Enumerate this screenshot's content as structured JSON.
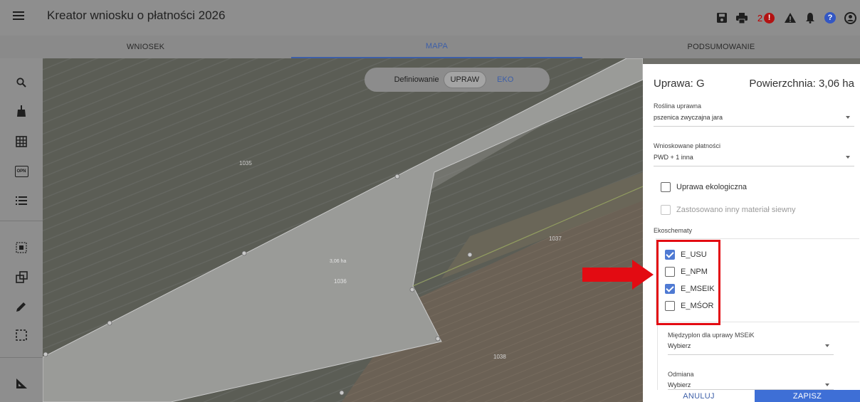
{
  "header": {
    "title": "Kreator wniosku o płatności 2026",
    "notification_count": "2",
    "icons": [
      "menu-icon",
      "save-icon",
      "print-icon",
      "error-icon",
      "warning-icon",
      "bell-icon",
      "help-icon",
      "account-icon"
    ]
  },
  "tabs": [
    {
      "label": "WNIOSEK"
    },
    {
      "label": "MAPA",
      "active": true
    },
    {
      "label": "PODSUMOWANIE"
    }
  ],
  "toolbar": {
    "icons": [
      "search-icon",
      "broom-icon",
      "grid-icon",
      "opn-icon",
      "list-icon",
      "select-area-icon",
      "copy-shape-icon",
      "pencil-icon",
      "dashed-select-icon",
      "measure-icon"
    ],
    "opn_text": "OPN"
  },
  "map": {
    "mode_label": "Definiowanie",
    "mode_options": [
      "UPRAW",
      "EKO"
    ],
    "parcel_labels": [
      "1035",
      "1036",
      "1037",
      "1038"
    ],
    "area_label": "3,06 ha"
  },
  "panel": {
    "title": "Uprawa: G",
    "area": "Powierzchnia: 3,06 ha",
    "crop_label": "Roślina uprawna",
    "crop_value": "pszenica zwyczajna jara",
    "payments_label": "Wnioskowane płatności",
    "payments_value": "PWD + 1 inna",
    "eco_crop_label": "Uprawa ekologiczna",
    "other_seed_label": "Zastosowano inny materiał siewny",
    "ecoschemes_label": "Ekoschematy",
    "ecoschemes": [
      {
        "label": "E_USU",
        "checked": true
      },
      {
        "label": "E_NPM",
        "checked": false
      },
      {
        "label": "E_MSEIK",
        "checked": true
      },
      {
        "label": "E_MŚOR",
        "checked": false
      }
    ],
    "catch_crop_label": "Międzyplon dla uprawy MSEiK",
    "catch_crop_value": "Wybierz",
    "variety_label": "Odmiana",
    "variety_value": "Wybierz",
    "cancel_label": "ANULUJ",
    "save_label": "ZAPISZ"
  },
  "colors": {
    "accent": "#3e6fd6",
    "annotation": "#e30b12",
    "overlay": "#8e8e8e"
  }
}
